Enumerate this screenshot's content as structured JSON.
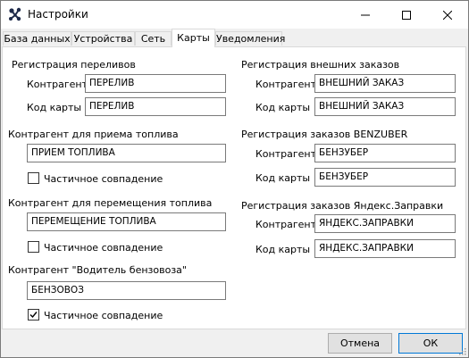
{
  "window": {
    "title": "Настройки",
    "app_icon": "network-nodes-icon"
  },
  "tabs": [
    "База данных",
    "Устройства",
    "Сеть",
    "Карты",
    "Уведомления"
  ],
  "active_tab": "Карты",
  "left": {
    "overflow": {
      "header": "Регистрация переливов",
      "counterparty_label": "Контрагент",
      "counterparty_value": "ПЕРЕЛИВ",
      "card_label": "Код карты",
      "card_value": "ПЕРЕЛИВ"
    },
    "fuel_receipt": {
      "header": "Контрагент для приема топлива",
      "value": "ПРИЕМ ТОПЛИВА",
      "partial_label": "Частичное совпадение",
      "partial_checked": false
    },
    "fuel_transfer": {
      "header": "Контрагент для перемещения топлива",
      "value": "ПЕРЕМЕЩЕНИЕ ТОПЛИВА",
      "partial_label": "Частичное совпадение",
      "partial_checked": false
    },
    "truck_driver": {
      "header": "Контрагент \"Водитель бензовоза\"",
      "value": "БЕНЗОВОЗ",
      "partial_label": "Частичное совпадение",
      "partial_checked": true
    }
  },
  "right": {
    "external": {
      "header": "Регистрация внешних заказов",
      "counterparty_label": "Контрагент",
      "counterparty_value": "ВНЕШНИЙ ЗАКАЗ",
      "card_label": "Код карты",
      "card_value": "ВНЕШНИЙ ЗАКАЗ"
    },
    "benzuber": {
      "header": "Регистрация заказов BENZUBER",
      "counterparty_label": "Контрагент",
      "counterparty_value": "БЕНЗУБЕР",
      "card_label": "Код карты",
      "card_value": "БЕНЗУБЕР"
    },
    "yandex": {
      "header": "Регистрация заказов Яндекс.Заправки",
      "counterparty_label": "Контрагент",
      "counterparty_value": "ЯНДЕКС.ЗАПРАВКИ",
      "card_label": "Код карты",
      "card_value": "ЯНДЕКС.ЗАПРАВКИ"
    }
  },
  "buttons": {
    "cancel": "Отмена",
    "ok": "ОК"
  },
  "colors": {
    "window_bg": "#f0f0f0",
    "field_border": "#7a7a7a",
    "default_button_border": "#0078d7"
  }
}
